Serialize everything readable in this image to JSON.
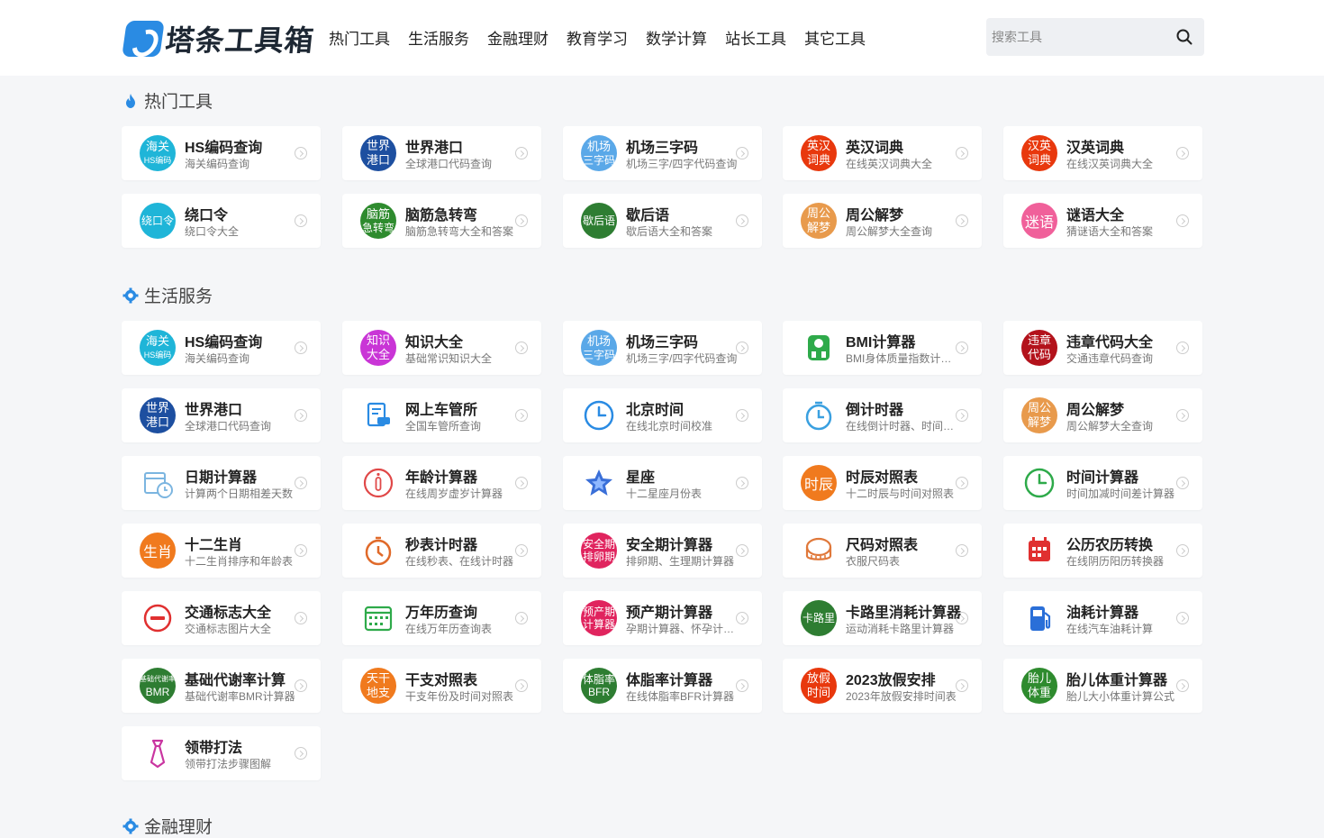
{
  "header": {
    "logo_text": "塔条工具箱",
    "nav": [
      "热门工具",
      "生活服务",
      "金融理财",
      "教育学习",
      "数学计算",
      "站长工具",
      "其它工具"
    ],
    "search_placeholder": "搜索工具"
  },
  "sections": [
    {
      "title": "热门工具",
      "icon": "flame-icon",
      "items": [
        {
          "title": "HS编码查询",
          "desc": "海关编码查询",
          "icon": {
            "kind": "text",
            "l1": "海关",
            "l2": "HS编码",
            "bg": "#1fb5d8"
          }
        },
        {
          "title": "世界港口",
          "desc": "全球港口代码查询",
          "icon": {
            "kind": "text",
            "l1": "世界",
            "l2": "港口",
            "bg": "#1d4fa0"
          }
        },
        {
          "title": "机场三字码",
          "desc": "机场三字/四字代码查询",
          "icon": {
            "kind": "text",
            "l1": "机场",
            "l2": "三字码",
            "bg": "#5aa8e8"
          }
        },
        {
          "title": "英汉词典",
          "desc": "在线英汉词典大全",
          "icon": {
            "kind": "text",
            "l1": "英汉",
            "l2": "词典",
            "bg": "#e8380d"
          }
        },
        {
          "title": "汉英词典",
          "desc": "在线汉英词典大全",
          "icon": {
            "kind": "text",
            "l1": "汉英",
            "l2": "词典",
            "bg": "#e8380d"
          }
        },
        {
          "title": "绕口令",
          "desc": "绕口令大全",
          "icon": {
            "kind": "text",
            "l1": "绕口令",
            "l2": "",
            "bg": "#1fb5d8"
          }
        },
        {
          "title": "脑筋急转弯",
          "desc": "脑筋急转弯大全和答案",
          "icon": {
            "kind": "text",
            "l1": "脑筋",
            "l2": "急转弯",
            "bg": "#2e8b2e"
          }
        },
        {
          "title": "歇后语",
          "desc": "歇后语大全和答案",
          "icon": {
            "kind": "text",
            "l1": "歇后语",
            "l2": "",
            "bg": "#2e7d32"
          }
        },
        {
          "title": "周公解梦",
          "desc": "周公解梦大全查询",
          "icon": {
            "kind": "text",
            "l1": "周公",
            "l2": "解梦",
            "bg": "#e89a4c"
          }
        },
        {
          "title": "谜语大全",
          "desc": "猜谜语大全和答案",
          "icon": {
            "kind": "text",
            "l1": "迷语",
            "l2": "",
            "bg": "#f0609a",
            "big": true
          }
        }
      ]
    },
    {
      "title": "生活服务",
      "icon": "gear-icon",
      "items": [
        {
          "title": "HS编码查询",
          "desc": "海关编码查询",
          "icon": {
            "kind": "text",
            "l1": "海关",
            "l2": "HS编码",
            "bg": "#1fb5d8"
          }
        },
        {
          "title": "知识大全",
          "desc": "基础常识知识大全",
          "icon": {
            "kind": "text",
            "l1": "知识",
            "l2": "大全",
            "bg": "#c935d6"
          }
        },
        {
          "title": "机场三字码",
          "desc": "机场三字/四字代码查询",
          "icon": {
            "kind": "text",
            "l1": "机场",
            "l2": "三字码",
            "bg": "#5aa8e8"
          }
        },
        {
          "title": "BMI计算器",
          "desc": "BMI身体质量指数计算器",
          "icon": {
            "kind": "glyph",
            "glyph": "scale-icon",
            "color": "#2eaa4a"
          }
        },
        {
          "title": "违章代码大全",
          "desc": "交通违章代码查询",
          "icon": {
            "kind": "text",
            "l1": "违章",
            "l2": "代码",
            "bg": "#b3121b"
          }
        },
        {
          "title": "世界港口",
          "desc": "全球港口代码查询",
          "icon": {
            "kind": "text",
            "l1": "世界",
            "l2": "港口",
            "bg": "#1d4fa0"
          }
        },
        {
          "title": "网上车管所",
          "desc": "全国车管所查询",
          "icon": {
            "kind": "glyph",
            "glyph": "car-doc-icon",
            "color": "#2a8be3"
          }
        },
        {
          "title": "北京时间",
          "desc": "在线北京时间校准",
          "icon": {
            "kind": "glyph",
            "glyph": "clock-icon",
            "color": "#2a8be3"
          }
        },
        {
          "title": "倒计时器",
          "desc": "在线倒计时器、时间倒数计时器",
          "icon": {
            "kind": "glyph",
            "glyph": "timer-icon",
            "color": "#3aa0e0"
          }
        },
        {
          "title": "周公解梦",
          "desc": "周公解梦大全查询",
          "icon": {
            "kind": "text",
            "l1": "周公",
            "l2": "解梦",
            "bg": "#e89a4c"
          }
        },
        {
          "title": "日期计算器",
          "desc": "计算两个日期相差天数",
          "icon": {
            "kind": "glyph",
            "glyph": "calendar-clock-icon",
            "color": "#7bb5e0"
          }
        },
        {
          "title": "年龄计算器",
          "desc": "在线周岁虚岁计算器",
          "icon": {
            "kind": "glyph",
            "glyph": "info-icon",
            "color": "#e04848"
          }
        },
        {
          "title": "星座",
          "desc": "十二星座月份表",
          "icon": {
            "kind": "glyph",
            "glyph": "star-icon",
            "color": "#3a6fd8"
          }
        },
        {
          "title": "时辰对照表",
          "desc": "十二时辰与时间对照表",
          "icon": {
            "kind": "text",
            "l1": "时辰",
            "l2": "",
            "bg": "#f07a1e",
            "big": true
          }
        },
        {
          "title": "时间计算器",
          "desc": "时间加减时间差计算器",
          "icon": {
            "kind": "glyph",
            "glyph": "clock-icon",
            "color": "#2eaa4a"
          }
        },
        {
          "title": "十二生肖",
          "desc": "十二生肖排序和年龄表",
          "icon": {
            "kind": "text",
            "l1": "生肖",
            "l2": "",
            "bg": "#f07a1e",
            "big": true
          }
        },
        {
          "title": "秒表计时器",
          "desc": "在线秒表、在线计时器",
          "icon": {
            "kind": "glyph",
            "glyph": "stopwatch-icon",
            "color": "#e06a2a"
          }
        },
        {
          "title": "安全期计算器",
          "desc": "排卵期、生理期计算器",
          "icon": {
            "kind": "text",
            "l1": "安全期",
            "l2": "排卵期",
            "bg": "#e0245e"
          }
        },
        {
          "title": "尺码对照表",
          "desc": "衣服尺码表",
          "icon": {
            "kind": "glyph",
            "glyph": "tape-icon",
            "color": "#e0783a"
          }
        },
        {
          "title": "公历农历转换",
          "desc": "在线阴历阳历转换器",
          "icon": {
            "kind": "glyph",
            "glyph": "calendar-icon",
            "color": "#e03030"
          }
        },
        {
          "title": "交通标志大全",
          "desc": "交通标志图片大全",
          "icon": {
            "kind": "glyph",
            "glyph": "no-entry-icon",
            "color": "#e03030"
          }
        },
        {
          "title": "万年历查询",
          "desc": "在线万年历查询表",
          "icon": {
            "kind": "glyph",
            "glyph": "calendar-grid-icon",
            "color": "#2eaa4a"
          }
        },
        {
          "title": "预产期计算器",
          "desc": "孕期计算器、怀孕计算器",
          "icon": {
            "kind": "text",
            "l1": "预产期",
            "l2": "计算器",
            "bg": "#e0245e"
          }
        },
        {
          "title": "卡路里消耗计算器",
          "desc": "运动消耗卡路里计算器",
          "icon": {
            "kind": "text",
            "l1": "卡路里",
            "l2": "",
            "bg": "#2e7d32"
          }
        },
        {
          "title": "油耗计算器",
          "desc": "在线汽车油耗计算",
          "icon": {
            "kind": "glyph",
            "glyph": "fuel-icon",
            "color": "#2a6fd8"
          }
        },
        {
          "title": "基础代谢率计算",
          "desc": "基础代谢率BMR计算器",
          "icon": {
            "kind": "text",
            "l1": "基础代谢率",
            "l2": "BMR",
            "bg": "#2e7d32"
          }
        },
        {
          "title": "干支对照表",
          "desc": "干支年份及时间对照表",
          "icon": {
            "kind": "text",
            "l1": "天干",
            "l2": "地支",
            "bg": "#f07a1e"
          }
        },
        {
          "title": "体脂率计算器",
          "desc": "在线体脂率BFR计算器",
          "icon": {
            "kind": "text",
            "l1": "体脂率",
            "l2": "BFR",
            "bg": "#2e7d32"
          }
        },
        {
          "title": "2023放假安排",
          "desc": "2023年放假安排时间表",
          "icon": {
            "kind": "text",
            "l1": "放假",
            "l2": "时间",
            "bg": "#e8380d"
          }
        },
        {
          "title": "胎儿体重计算器",
          "desc": "胎儿大小体重计算公式",
          "icon": {
            "kind": "text",
            "l1": "胎儿",
            "l2": "体重",
            "bg": "#2e8b2e"
          }
        },
        {
          "title": "领带打法",
          "desc": "领带打法步骤图解",
          "icon": {
            "kind": "glyph",
            "glyph": "tie-icon",
            "color": "#c935a0"
          }
        }
      ]
    },
    {
      "title": "金融理财",
      "icon": "gear-icon",
      "items": []
    }
  ]
}
